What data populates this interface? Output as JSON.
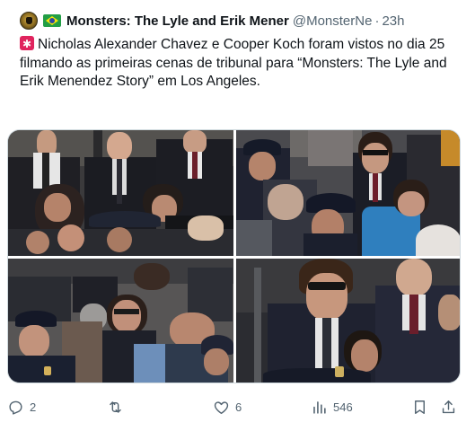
{
  "tweet": {
    "author_name": "Monsters: The Lyle and Erik Mener",
    "handle": "@MonsterNe",
    "separator": "·",
    "time": "23h",
    "text": "Nicholas Alexander Chavez e Cooper Koch foram vistos no dia 25 filmando as primeiras cenas de tribunal para “Monsters: The Lyle and Erik Menendez Story” em Los Angeles.",
    "icons": {
      "avatar": "profile-avatar",
      "flag": "brazil-flag-emoji",
      "siren": "police-siren-emoji"
    }
  },
  "media": {
    "photos": [
      {
        "description_icon": "photo"
      },
      {
        "description_icon": "photo"
      },
      {
        "description_icon": "photo"
      },
      {
        "description_icon": "photo"
      }
    ]
  },
  "actions": {
    "reply_count": "2",
    "retweet_count": "",
    "like_count": "6",
    "views_count": "546",
    "icons": [
      "reply-icon",
      "retweet-icon",
      "like-icon",
      "views-icon",
      "bookmark-icon",
      "share-icon"
    ]
  },
  "colors": {
    "text": "#0f1419",
    "secondary": "#536471",
    "border": "#cfd9de"
  }
}
